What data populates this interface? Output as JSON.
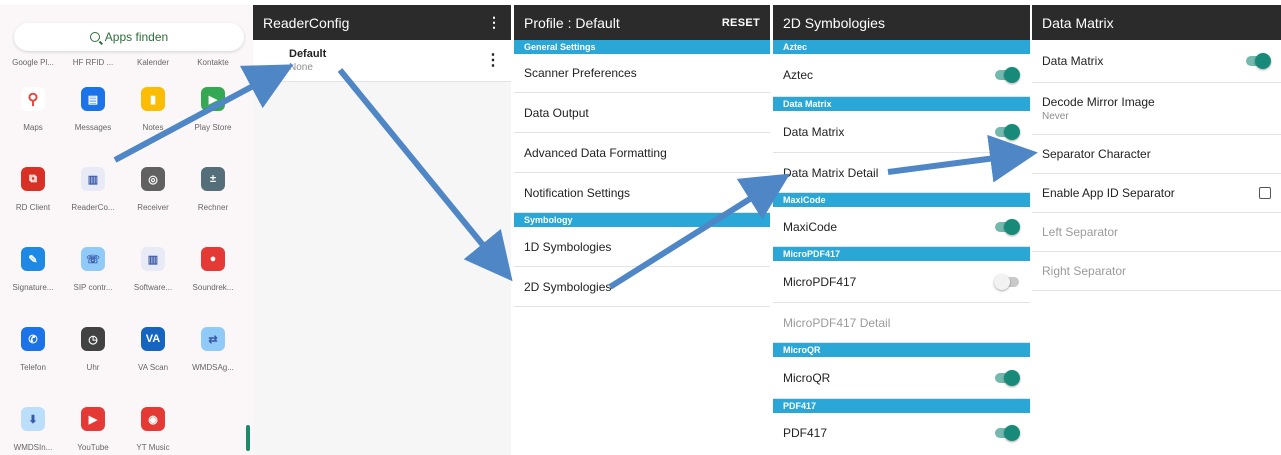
{
  "launcher": {
    "search_label": "Apps finden",
    "top_row": [
      "Google Pl...",
      "HF RFID ...",
      "Kalender",
      "Kontakte"
    ],
    "apps": [
      {
        "label": "Maps",
        "icon": "maps-icon",
        "color": "#ffffff",
        "glyph": "⚲"
      },
      {
        "label": "Messages",
        "icon": "messages-icon",
        "color": "#1a73e8",
        "glyph": "▤"
      },
      {
        "label": "Notes",
        "icon": "notes-icon",
        "color": "#fbbc04",
        "glyph": "▮"
      },
      {
        "label": "Play Store",
        "icon": "play-store-icon",
        "color": "#34a853",
        "glyph": "▶"
      },
      {
        "label": "RD Client",
        "icon": "rd-client-icon",
        "color": "#d93025",
        "glyph": "⧉"
      },
      {
        "label": "ReaderCo...",
        "icon": "reader-config-icon",
        "color": "#e8eaf6",
        "glyph": "▥"
      },
      {
        "label": "Receiver",
        "icon": "receiver-icon",
        "color": "#616161",
        "glyph": "◎"
      },
      {
        "label": "Rechner",
        "icon": "calculator-icon",
        "color": "#546e7a",
        "glyph": "±"
      },
      {
        "label": "Signature...",
        "icon": "signature-icon",
        "color": "#1e88e5",
        "glyph": "✎"
      },
      {
        "label": "SIP contr...",
        "icon": "sip-control-icon",
        "color": "#90caf9",
        "glyph": "☏"
      },
      {
        "label": "Software...",
        "icon": "software-icon",
        "color": "#e8eaf6",
        "glyph": "▥"
      },
      {
        "label": "Soundrek...",
        "icon": "sound-recorder-icon",
        "color": "#e53935",
        "glyph": "●"
      },
      {
        "label": "Telefon",
        "icon": "phone-icon",
        "color": "#1a73e8",
        "glyph": "✆"
      },
      {
        "label": "Uhr",
        "icon": "clock-icon",
        "color": "#424242",
        "glyph": "◷"
      },
      {
        "label": "VA Scan",
        "icon": "va-scan-icon",
        "color": "#1565c0",
        "glyph": "VA"
      },
      {
        "label": "WMDSAg...",
        "icon": "wmds-agent-icon",
        "color": "#90caf9",
        "glyph": "⇄"
      },
      {
        "label": "WMDSIn...",
        "icon": "wmds-installer-icon",
        "color": "#bbdefb",
        "glyph": "⬇"
      },
      {
        "label": "YouTube",
        "icon": "youtube-icon",
        "color": "#e53935",
        "glyph": "▶"
      },
      {
        "label": "YT Music",
        "icon": "yt-music-icon",
        "color": "#e53935",
        "glyph": "◉"
      },
      {
        "label": "",
        "icon": "",
        "color": "",
        "glyph": ""
      }
    ]
  },
  "reader_config": {
    "title": "ReaderConfig",
    "profile_name": "Default",
    "profile_sub": "None"
  },
  "profile": {
    "title": "Profile : Default",
    "reset": "RESET",
    "general_header": "General Settings",
    "items_general": [
      "Scanner Preferences",
      "Data Output",
      "Advanced Data Formatting",
      "Notification Settings"
    ],
    "symbology_header": "Symbology",
    "items_symbology": [
      "1D Symbologies",
      "2D Symbologies"
    ]
  },
  "symbologies": {
    "title": "2D Symbologies",
    "aztec_header": "Aztec",
    "aztec": "Aztec",
    "dm_header": "Data Matrix",
    "dm": "Data Matrix",
    "dm_detail": "Data Matrix Detail",
    "maxi_header": "MaxiCode",
    "maxi": "MaxiCode",
    "mpdf_header": "MicroPDF417",
    "mpdf": "MicroPDF417",
    "mpdf_detail": "MicroPDF417 Detail",
    "mqr_header": "MicroQR",
    "mqr": "MicroQR",
    "pdf_header": "PDF417",
    "pdf": "PDF417"
  },
  "data_matrix": {
    "title": "Data Matrix",
    "enable": "Data Matrix",
    "mirror": "Decode Mirror Image",
    "mirror_value": "Never",
    "separator": "Separator Character",
    "app_id": "Enable App ID Separator",
    "left": "Left Separator",
    "right": "Right Separator"
  },
  "colors": {
    "accent_blue": "#2aa7d6",
    "appbar": "#2b2b2b",
    "switch_on": "#178a79",
    "arrow": "#4f86c6"
  }
}
